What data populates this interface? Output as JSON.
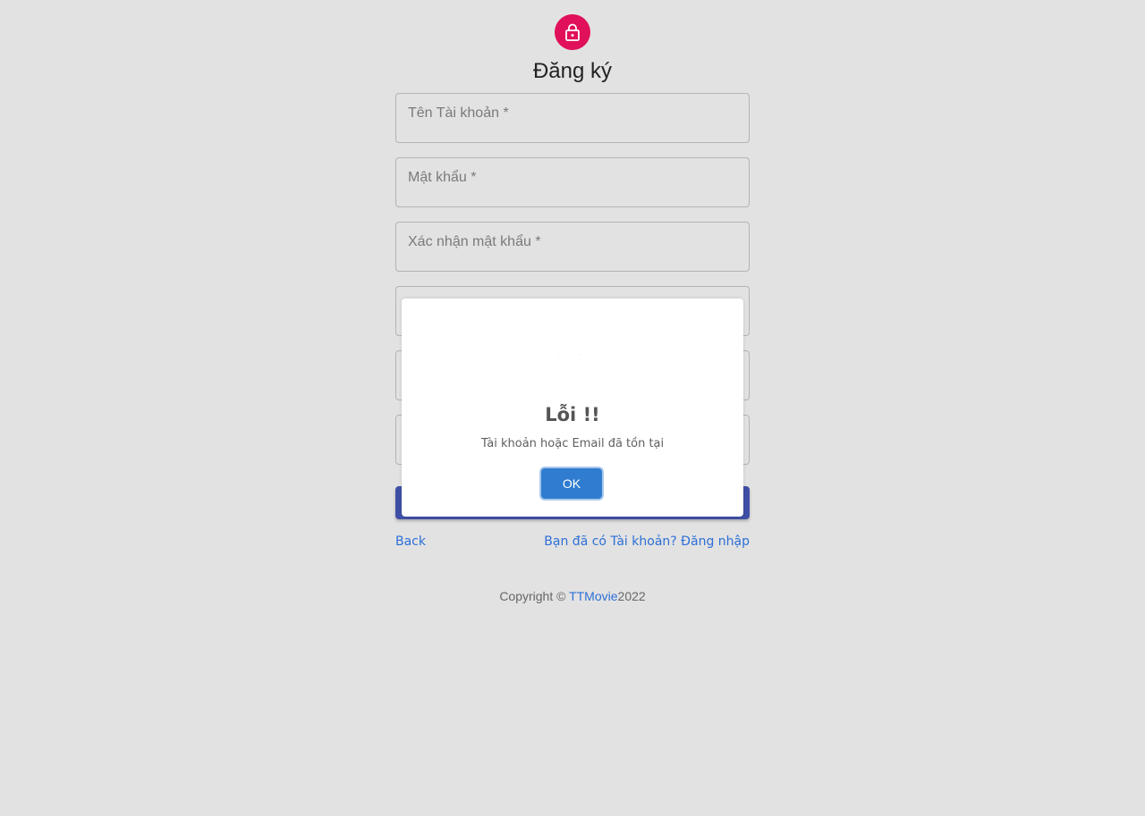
{
  "header": {
    "icon": "lock-icon",
    "title": "Đăng ký",
    "accent_color": "#e0105a"
  },
  "form": {
    "fields": [
      {
        "label": "Tên Tài khoản *"
      },
      {
        "label": "Mật khẩu *"
      },
      {
        "label": "Xác nhận mật khẩu *"
      },
      {
        "label": ""
      },
      {
        "label": ""
      },
      {
        "label": ""
      }
    ],
    "submit_color": "#3f4fa5"
  },
  "links": {
    "back": "Back",
    "login": "Bạn đã có Tài khoản? Đăng nhập"
  },
  "footer": {
    "prefix": "Copyright © ",
    "brand": "TTMovie",
    "year": "2022"
  },
  "dialog": {
    "title": "Lỗi !!",
    "message": "Tài khoản hoặc Email đã tồn tại",
    "ok_label": "OK",
    "ok_color": "#2f7cd0"
  }
}
